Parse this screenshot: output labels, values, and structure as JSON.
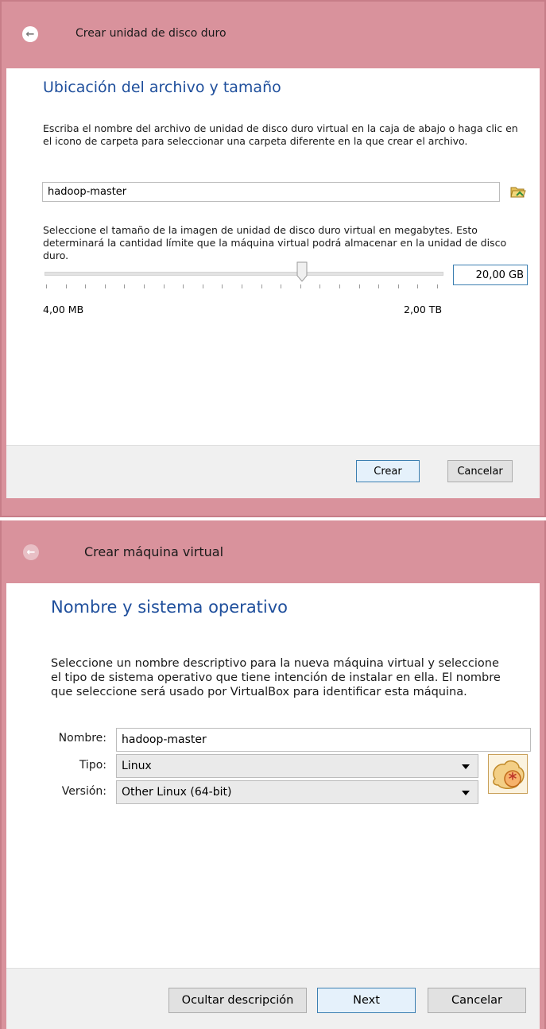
{
  "disk_dialog": {
    "window_title": "Crear unidad de disco duro",
    "heading": "Ubicación del archivo y tamaño",
    "description_1": "Escriba el nombre del archivo de unidad de disco duro virtual en la caja de abajo o haga clic en el icono de carpeta para seleccionar una carpeta diferente en la que crear el archivo.",
    "file_name": "hadoop-master",
    "description_2": "Seleccione el tamaño de la imagen de unidad de disco duro virtual en megabytes. Esto determinará la cantidad límite que la máquina virtual podrá almacenar en la unidad de disco duro.",
    "size_value": "20,00 GB",
    "slider_min_label": "4,00 MB",
    "slider_max_label": "2,00 TB",
    "create_button": "Crear",
    "cancel_button": "Cancelar",
    "folder_icon": "folder-open-icon",
    "back_icon": "back-arrow-icon"
  },
  "vm_dialog": {
    "window_title": "Crear máquina virtual",
    "heading": "Nombre y sistema operativo",
    "description": "Seleccione un nombre descriptivo para la nueva máquina virtual y seleccione el tipo de sistema operativo que tiene intención de instalar en ella. El nombre que seleccione será usado por VirtualBox para identificar esta máquina.",
    "name_label": "Nombre:",
    "name_value": "hadoop-master",
    "type_label": "Tipo:",
    "type_value": "Linux",
    "version_label": "Versión:",
    "version_value": "Other Linux (64-bit)",
    "hide_description_button": "Ocultar descripción",
    "next_button": "Next",
    "cancel_button": "Cancelar",
    "os_icon": "linux-os-icon",
    "back_icon": "back-arrow-icon"
  },
  "colors": {
    "titlebar": "#d9929c",
    "heading": "#1f4f9c",
    "default_button_border": "#3c7fb1"
  }
}
